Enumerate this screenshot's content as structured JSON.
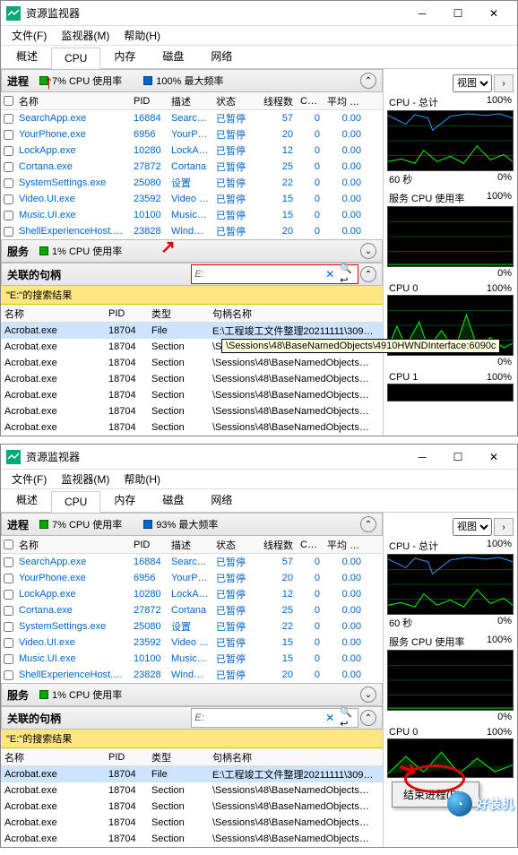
{
  "app_icon_color": "#0a7",
  "title": "资源监视器",
  "menu": [
    "文件(F)",
    "监视器(M)",
    "帮助(H)"
  ],
  "tabs": [
    "概述",
    "CPU",
    "内存",
    "磁盘",
    "网络"
  ],
  "active_tab": "CPU",
  "proc_section": {
    "name": "进程",
    "usage1": "7% CPU 使用率",
    "usage2_top": "100% 最大频率",
    "usage2_bot": "93% 最大频率"
  },
  "proc_cols": [
    "名称",
    "PID",
    "描述",
    "状态",
    "线程数",
    "CPU",
    "平均 CPU"
  ],
  "proc_rows": [
    {
      "name": "SearchApp.exe",
      "pid": "16884",
      "desc": "Search…",
      "stat": "已暂停",
      "thr": "57",
      "cpu": "0",
      "avg": "0.00"
    },
    {
      "name": "YourPhone.exe",
      "pid": "6956",
      "desc": "YourPh…",
      "stat": "已暂停",
      "thr": "20",
      "cpu": "0",
      "avg": "0.00"
    },
    {
      "name": "LockApp.exe",
      "pid": "10280",
      "desc": "LockAp…",
      "stat": "已暂停",
      "thr": "12",
      "cpu": "0",
      "avg": "0.00"
    },
    {
      "name": "Cortana.exe",
      "pid": "27872",
      "desc": "Cortana",
      "stat": "已暂停",
      "thr": "25",
      "cpu": "0",
      "avg": "0.00"
    },
    {
      "name": "SystemSettings.exe",
      "pid": "25080",
      "desc": "设置",
      "stat": "已暂停",
      "thr": "22",
      "cpu": "0",
      "avg": "0.00"
    },
    {
      "name": "Video.UI.exe",
      "pid": "23592",
      "desc": "Video …",
      "stat": "已暂停",
      "thr": "15",
      "cpu": "0",
      "avg": "0.00"
    },
    {
      "name": "Music.UI.exe",
      "pid": "10100",
      "desc": "Music…",
      "stat": "已暂停",
      "thr": "15",
      "cpu": "0",
      "avg": "0.00"
    },
    {
      "name": "ShellExperienceHost.exe",
      "pid": "23828",
      "desc": "Windo…",
      "stat": "已暂停",
      "thr": "20",
      "cpu": "0",
      "avg": "0.00"
    }
  ],
  "svc_section": {
    "name": "服务",
    "usage": "1% CPU 使用率"
  },
  "handles_section": {
    "name": "关联的句柄"
  },
  "search_value": "E:",
  "yellowbar_text": "\"E:\"的搜索结果",
  "handle_cols": [
    "名称",
    "PID",
    "类型",
    "句柄名称"
  ],
  "handle_rows": [
    {
      "name": "Acrobat.exe",
      "pid": "18704",
      "type": "File",
      "handle": "E:\\工程竣工文件整理20211111\\309…",
      "sel": true
    },
    {
      "name": "Acrobat.exe",
      "pid": "18704",
      "type": "Section",
      "handle": "\\Sessions\\48\\BaseNamedObjects…"
    },
    {
      "name": "Acrobat.exe",
      "pid": "18704",
      "type": "Section",
      "handle": "\\Sessions\\48\\BaseNamedObjects…"
    },
    {
      "name": "Acrobat.exe",
      "pid": "18704",
      "type": "Section",
      "handle": "\\Sessions\\48\\BaseNamedObjects…"
    },
    {
      "name": "Acrobat.exe",
      "pid": "18704",
      "type": "Section",
      "handle": "\\Sessions\\48\\BaseNamedObjects…"
    },
    {
      "name": "Acrobat.exe",
      "pid": "18704",
      "type": "Section",
      "handle": "\\Sessions\\48\\BaseNamedObjects…"
    },
    {
      "name": "Acrobat.exe",
      "pid": "18704",
      "type": "Section",
      "handle": "\\Sessions\\48\\BaseNamedObjects…"
    }
  ],
  "tooltip_text": "\\Sessions\\48\\BaseNamedObjects\\4910HWNDInterface:6090c",
  "side": {
    "view_label": "视图",
    "g1_title": "CPU - 总计",
    "g1_right": "100%",
    "g1_foot_l": "60 秒",
    "g1_foot_r": "0%",
    "g2_title": "服务 CPU 使用率",
    "g2_right": "100%",
    "g2_foot_r": "0%",
    "g3_title": "CPU 0",
    "g3_right": "100%",
    "g3_foot_r": "0%",
    "g4_title": "CPU 1",
    "g4_right": "100%"
  },
  "ctx_item": "结束进程(E)",
  "logo_text": "好装机"
}
